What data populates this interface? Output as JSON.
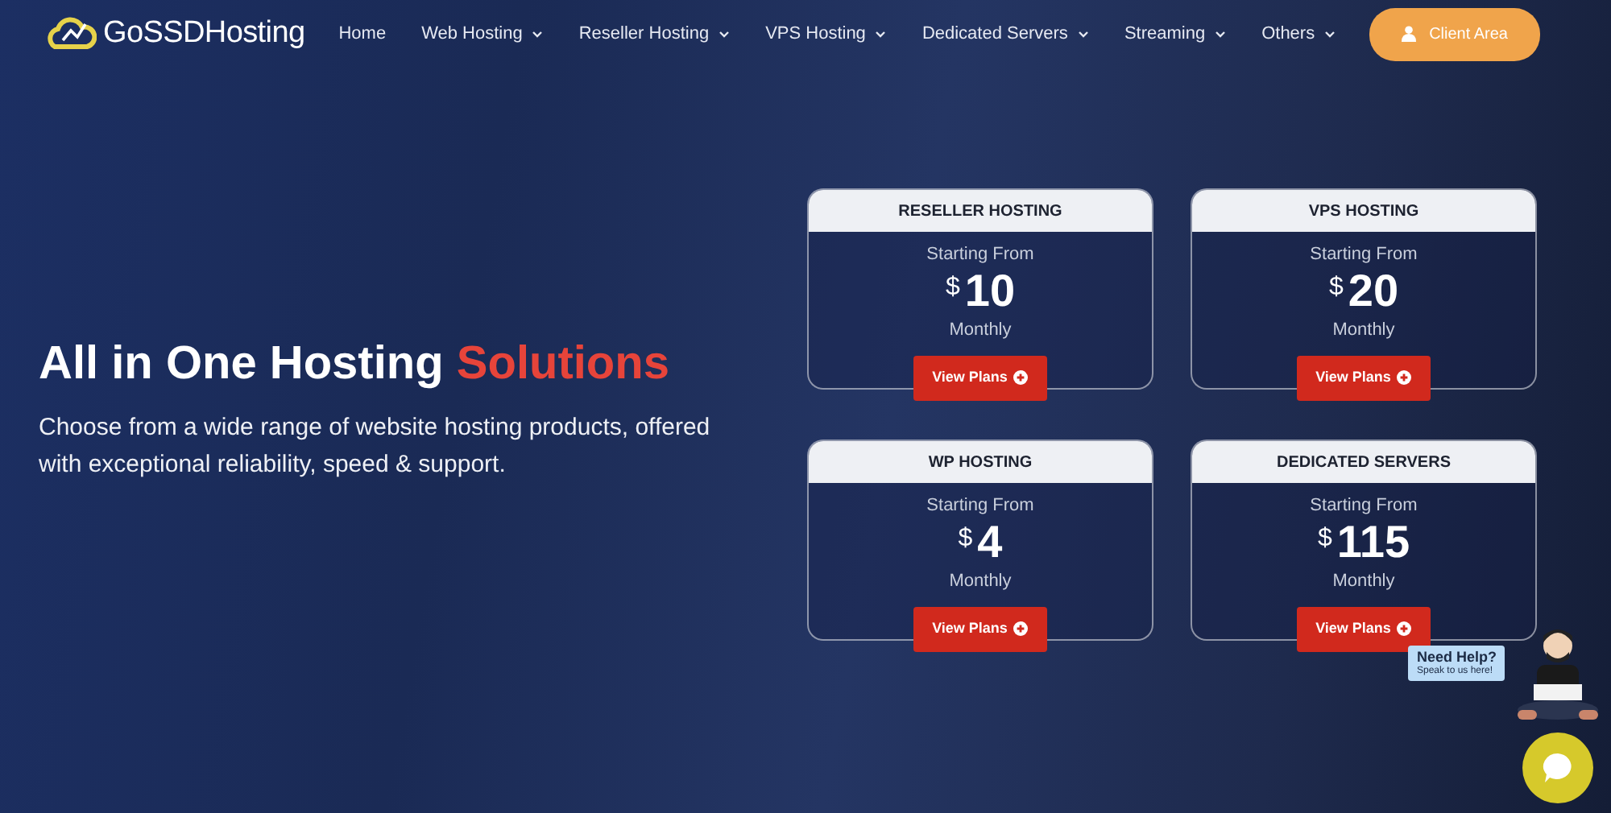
{
  "brand": {
    "name": "GoSSDHosting"
  },
  "nav": [
    {
      "label": "Home",
      "dropdown": false
    },
    {
      "label": "Web Hosting",
      "dropdown": true
    },
    {
      "label": "Reseller Hosting",
      "dropdown": true
    },
    {
      "label": "VPS Hosting",
      "dropdown": true
    },
    {
      "label": "Dedicated Servers",
      "dropdown": true
    },
    {
      "label": "Streaming",
      "dropdown": true
    },
    {
      "label": "Others",
      "dropdown": true
    }
  ],
  "client_area": {
    "label": "Client Area"
  },
  "hero": {
    "headline": "All in One Hosting ",
    "headline_highlight": "Solutions",
    "subtitle": "Choose from a wide range of website hosting products, offered with exceptional reliability, speed & support."
  },
  "plans": [
    {
      "title": "RESELLER HOSTING",
      "starting": "Starting From",
      "currency": "$",
      "price": "10",
      "period": "Monthly",
      "button": "View Plans"
    },
    {
      "title": "VPS HOSTING",
      "starting": "Starting From",
      "currency": "$",
      "price": "20",
      "period": "Monthly",
      "button": "View Plans"
    },
    {
      "title": "WP HOSTING",
      "starting": "Starting From",
      "currency": "$",
      "price": "4",
      "period": "Monthly",
      "button": "View Plans"
    },
    {
      "title": "DEDICATED SERVERS",
      "starting": "Starting From",
      "currency": "$",
      "price": "115",
      "period": "Monthly",
      "button": "View Plans"
    }
  ],
  "chat": {
    "title": "Need Help?",
    "subtitle": "Speak to us here!"
  }
}
